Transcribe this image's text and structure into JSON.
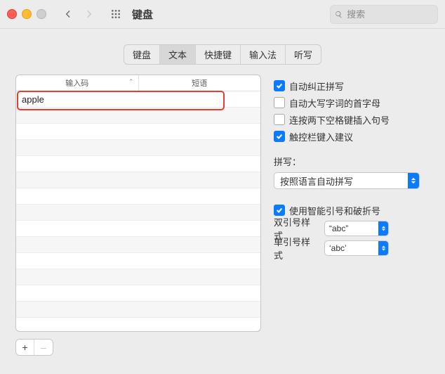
{
  "window": {
    "title": "键盘"
  },
  "search": {
    "placeholder": "搜索"
  },
  "tabs": {
    "items": [
      "键盘",
      "文本",
      "快捷键",
      "输入法",
      "听写"
    ],
    "active_index": 1
  },
  "table": {
    "headers": {
      "col1": "输入码",
      "col2": "短语"
    },
    "rows": [
      {
        "replace": "apple",
        "with_": ""
      }
    ]
  },
  "buttons": {
    "add": "+",
    "remove": "–"
  },
  "options": {
    "autocorrect": {
      "checked": true,
      "label": "自动纠正拼写"
    },
    "capitalize": {
      "checked": false,
      "label": "自动大写字词的首字母"
    },
    "doublespace": {
      "checked": false,
      "label": "连按两下空格键插入句号"
    },
    "touchbar": {
      "checked": true,
      "label": "触控栏键入建议"
    },
    "smartquotes": {
      "checked": true,
      "label": "使用智能引号和破折号"
    }
  },
  "spelling": {
    "label": "拼写：",
    "value": "按照语言自动拼写"
  },
  "doublequote": {
    "label": "双引号样式",
    "value": "“abc”"
  },
  "singlequote": {
    "label": "单引号样式",
    "value": "‘abc’"
  }
}
